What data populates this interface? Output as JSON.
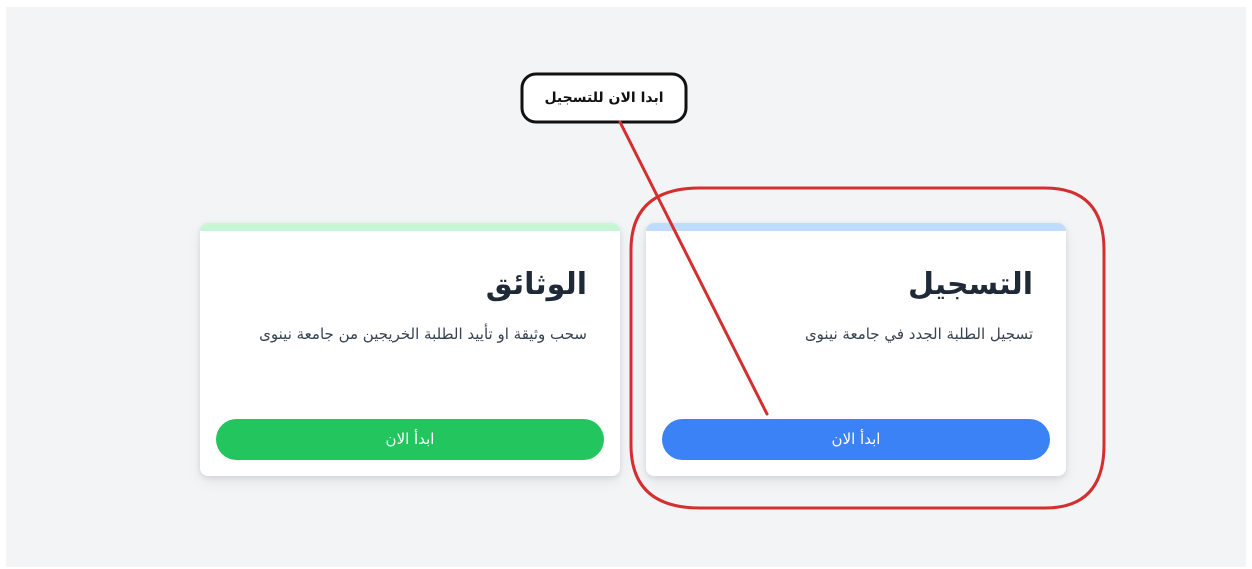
{
  "annotation": {
    "callout_text": "ابدا الان للتسجيل"
  },
  "cards": [
    {
      "id": "documents",
      "title": "الوثائق",
      "description": "سحب وثيقة او تأييد الطلبة الخريجين من جامعة نينوى",
      "button_label": "ابدأ الان",
      "strip_color": "#c6f6d5",
      "button_color": "#22c55e"
    },
    {
      "id": "registration",
      "title": "التسجيل",
      "description": "تسجيل الطلبة الجدد في جامعة نينوى",
      "button_label": "ابدأ الان",
      "strip_color": "#bfdbfe",
      "button_color": "#3b82f6"
    }
  ],
  "colors": {
    "page_background": "#f3f4f6",
    "annotation_red": "#d32f2f",
    "callout_border": "#111111"
  }
}
